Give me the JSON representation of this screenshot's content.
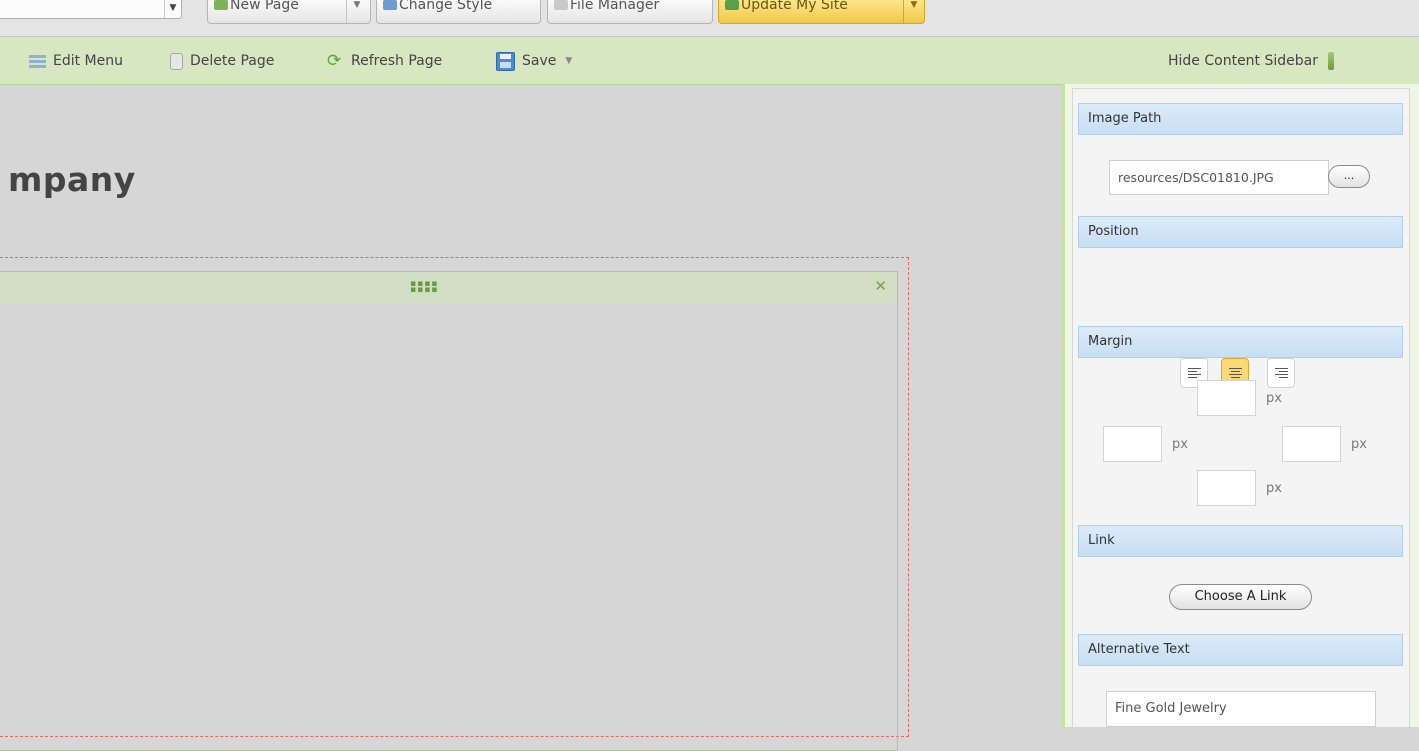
{
  "top_bar": {
    "new_page": "New Page",
    "change_style": "Change Style",
    "file_manager": "File Manager",
    "update_site": "Update My Site"
  },
  "toolbar": {
    "edit_menu": "Edit Menu",
    "delete_page": "Delete Page",
    "refresh_page": "Refresh Page",
    "save": "Save",
    "hide_sidebar": "Hide Content Sidebar"
  },
  "page": {
    "heading": "mpany"
  },
  "sidebar": {
    "image_path": {
      "title": "Image Path",
      "value": "resources/DSC01810.JPG",
      "browse_label": "..."
    },
    "position": {
      "title": "Position",
      "options": [
        "left",
        "center",
        "right"
      ],
      "selected": "center"
    },
    "margin": {
      "title": "Margin",
      "unit": "px"
    },
    "link": {
      "title": "Link",
      "button": "Choose A Link"
    },
    "alt_text": {
      "title": "Alternative Text",
      "value": "Fine Gold Jewelry"
    }
  },
  "colors": {
    "toolbar_bg": "#d6e7c2",
    "section_header": "#c7def3",
    "active_align": "#fbd974",
    "update_button": "#f1c94a"
  }
}
